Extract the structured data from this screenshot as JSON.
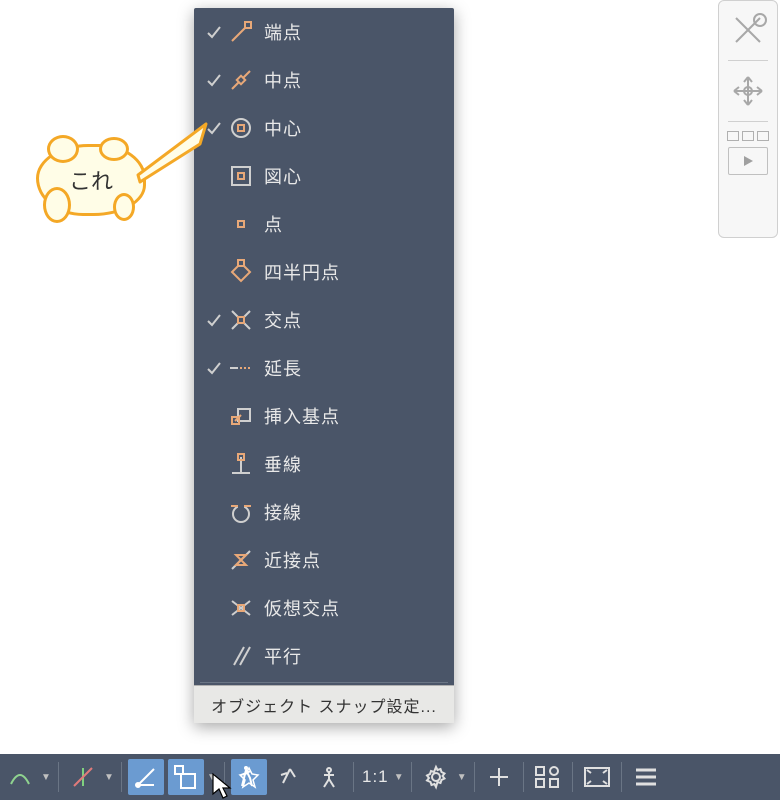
{
  "menu": {
    "items": [
      {
        "label": "端点",
        "checked": true,
        "icon": "endpoint"
      },
      {
        "label": "中点",
        "checked": true,
        "icon": "midpoint"
      },
      {
        "label": "中心",
        "checked": true,
        "icon": "center"
      },
      {
        "label": "図心",
        "checked": false,
        "icon": "centroid"
      },
      {
        "label": "点",
        "checked": false,
        "icon": "point"
      },
      {
        "label": "四半円点",
        "checked": false,
        "icon": "quadrant"
      },
      {
        "label": "交点",
        "checked": true,
        "icon": "intersection"
      },
      {
        "label": "延長",
        "checked": true,
        "icon": "extend"
      },
      {
        "label": "挿入基点",
        "checked": false,
        "icon": "insert"
      },
      {
        "label": "垂線",
        "checked": false,
        "icon": "perpendicular"
      },
      {
        "label": "接線",
        "checked": false,
        "icon": "tangent"
      },
      {
        "label": "近接点",
        "checked": false,
        "icon": "nearest"
      },
      {
        "label": "仮想交点",
        "checked": false,
        "icon": "apparent"
      },
      {
        "label": "平行",
        "checked": false,
        "icon": "parallel"
      }
    ],
    "footer": "オブジェクト スナップ設定..."
  },
  "callout": {
    "text": "これ"
  },
  "statusbar": {
    "scale": "1:1"
  }
}
